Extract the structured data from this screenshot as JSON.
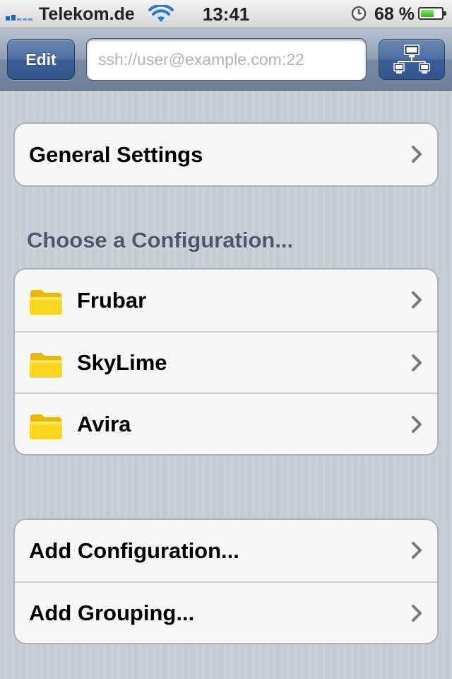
{
  "status_bar": {
    "carrier": "Telekom.de",
    "time": "13:41",
    "battery_percent": "68 %",
    "battery_level": 0.68
  },
  "navbar": {
    "edit_label": "Edit",
    "ssh_placeholder": "ssh://user@example.com:22",
    "network_button_icon": "network-icon"
  },
  "general_group": {
    "items": [
      {
        "label": "General Settings"
      }
    ]
  },
  "configurations": {
    "header": "Choose a Configuration...",
    "items": [
      {
        "label": "Frubar",
        "icon": "folder-icon"
      },
      {
        "label": "SkyLime",
        "icon": "folder-icon"
      },
      {
        "label": "Avira",
        "icon": "folder-icon"
      }
    ]
  },
  "actions_group": {
    "items": [
      {
        "label": "Add Configuration..."
      },
      {
        "label": "Add Grouping..."
      }
    ]
  },
  "colors": {
    "accent_blue": "#3b5e98",
    "folder_yellow": "#f8d21c",
    "section_header": "#4c566c"
  }
}
